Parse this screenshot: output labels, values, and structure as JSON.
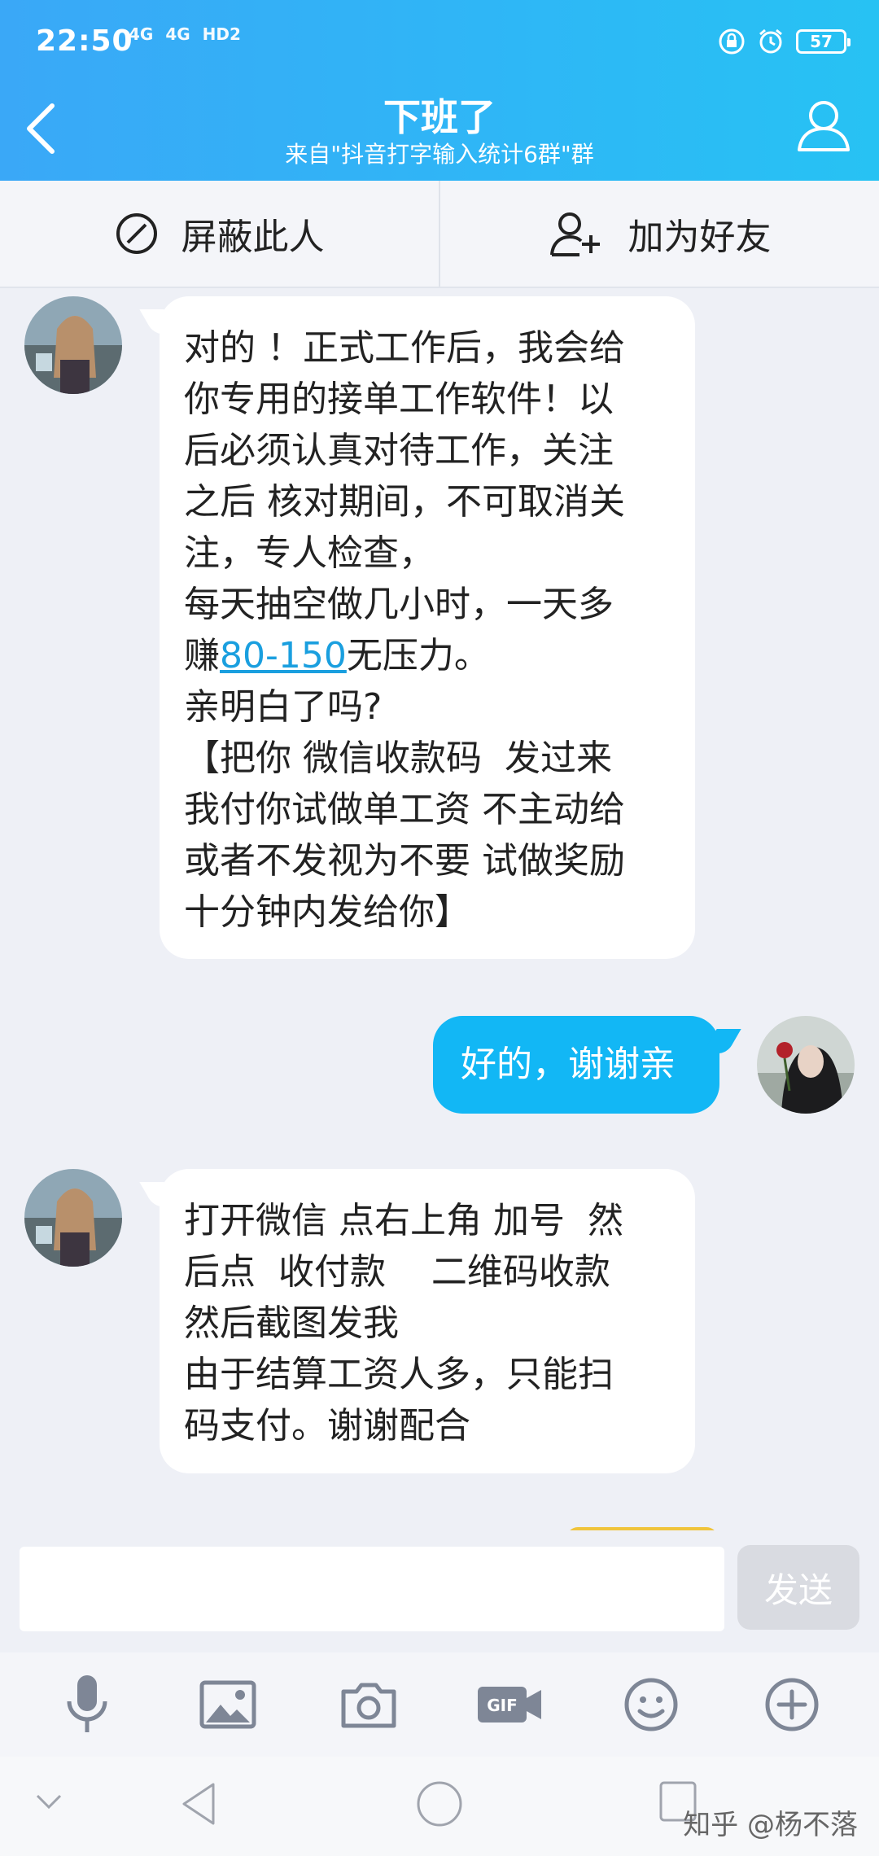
{
  "status": {
    "time": "22:50",
    "network": [
      "4G",
      "4G",
      "HD2"
    ],
    "battery": "57"
  },
  "header": {
    "title": "下班了",
    "subtitle": "来自\"抖音打字输入统计6群\"群"
  },
  "actions": {
    "block_label": "屏蔽此人",
    "add_friend_label": "加为好友"
  },
  "messages": [
    {
      "side": "left",
      "lines": [
        "对的 ！正式工作后，我会给",
        "你专用的接单工作软件！以",
        "后必须认真对待工作，关注",
        "之后 核对期间，不可取消关",
        "注，专人检查，",
        "每天抽空做几小时，一天多",
        "赚",
        "亲明白了吗?",
        "【把你 微信收款码  发过来",
        "我付你试做单工资 不主动给",
        "或者不发视为不要 试做奖励",
        "十分钟内发给你】"
      ],
      "link_text": "80-150",
      "after_link": "无压力。"
    },
    {
      "side": "right",
      "text": "好的，谢谢亲"
    },
    {
      "side": "left",
      "lines": [
        "打开微信 点右上角 加号  然",
        "后点  收付款    二维码收款",
        "然后截图发我",
        "由于结算工资人多，只能扫",
        "码支付。谢谢配合"
      ]
    }
  ],
  "input": {
    "placeholder": "",
    "send_label": "发送"
  },
  "toolbar": [
    "microphone-icon",
    "image-icon",
    "camera-icon",
    "gif-icon",
    "emoji-icon",
    "plus-icon"
  ],
  "watermark": "知乎 @杨不落",
  "colors": {
    "header_start": "#3aa8f7",
    "header_end": "#27c2f3",
    "outgoing_bubble": "#12b7f5",
    "incoming_bubble": "#ffffff",
    "link": "#1a9fdf"
  }
}
